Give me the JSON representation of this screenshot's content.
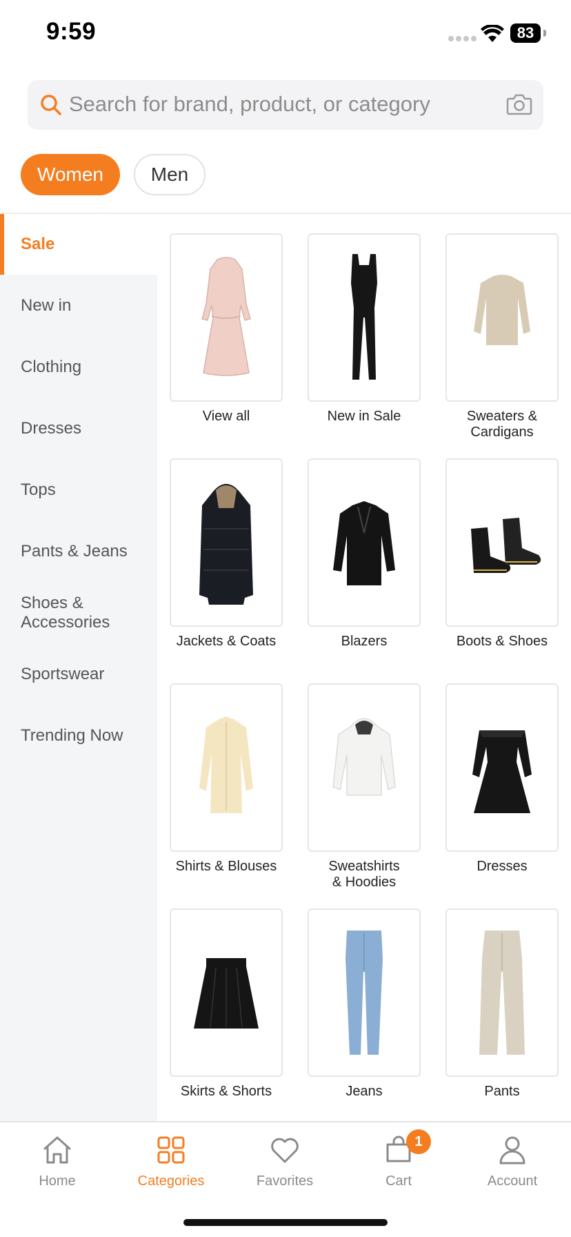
{
  "status_bar": {
    "time": "9:59",
    "battery": "83"
  },
  "search": {
    "placeholder": "Search for brand, product, or category"
  },
  "gender_tabs": [
    {
      "label": "Women",
      "active": true
    },
    {
      "label": "Men",
      "active": false
    }
  ],
  "sidebar": {
    "items": [
      {
        "label": "Sale",
        "active": true
      },
      {
        "label": "New in"
      },
      {
        "label": "Clothing"
      },
      {
        "label": "Dresses"
      },
      {
        "label": "Tops"
      },
      {
        "label": "Pants & Jeans"
      },
      {
        "label": "Shoes &\nAccessories"
      },
      {
        "label": "Sportswear"
      },
      {
        "label": "Trending Now"
      }
    ]
  },
  "categories": [
    {
      "label": "View all",
      "icon": "dress-pink-icon"
    },
    {
      "label": "New in Sale",
      "icon": "jumpsuit-black-icon"
    },
    {
      "label": "Sweaters &\nCardigans",
      "icon": "sweater-beige-icon"
    },
    {
      "label": "Jackets & Coats",
      "icon": "puffer-coat-icon"
    },
    {
      "label": "Blazers",
      "icon": "blazer-icon"
    },
    {
      "label": "Boots & Shoes",
      "icon": "boots-icon"
    },
    {
      "label": "Shirts & Blouses",
      "icon": "shirt-cream-icon"
    },
    {
      "label": "Sweatshirts\n& Hoodies",
      "icon": "hoodie-white-icon"
    },
    {
      "label": "Dresses",
      "icon": "dress-black-icon"
    },
    {
      "label": "Skirts & Shorts",
      "icon": "skirt-black-icon"
    },
    {
      "label": "Jeans",
      "icon": "jeans-icon"
    },
    {
      "label": "Pants",
      "icon": "pants-beige-icon"
    }
  ],
  "bottom_nav": {
    "items": [
      {
        "label": "Home",
        "icon": "home-icon"
      },
      {
        "label": "Categories",
        "icon": "categories-icon",
        "active": true
      },
      {
        "label": "Favorites",
        "icon": "heart-icon"
      },
      {
        "label": "Cart",
        "icon": "cart-icon",
        "badge": "1"
      },
      {
        "label": "Account",
        "icon": "account-icon"
      }
    ]
  },
  "colors": {
    "accent": "#f47d20",
    "sidebar_bg": "#f4f5f7"
  }
}
